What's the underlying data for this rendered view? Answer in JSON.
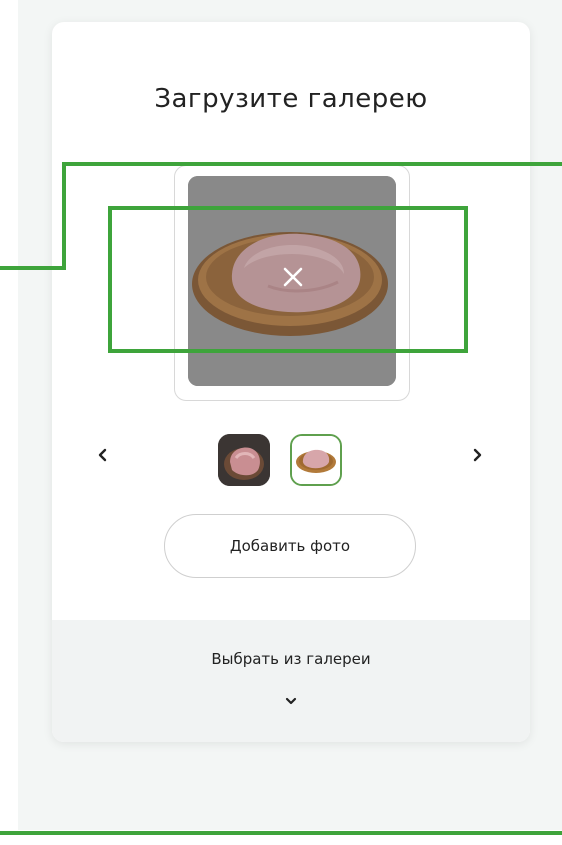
{
  "card": {
    "title": "Загрузите галерею",
    "add_photo_label": "Добавить фото",
    "gallery_select_label": "Выбрать из галереи"
  },
  "preview": {
    "image_icon": "meat-on-board-image",
    "remove_icon": "close-icon"
  },
  "carousel": {
    "prev_icon": "chevron-left-icon",
    "next_icon": "chevron-right-icon",
    "thumbnails": [
      "meat-photo-1",
      "meat-photo-2"
    ],
    "selected_index": 1
  },
  "colors": {
    "annotation_green": "#3ea43b",
    "accent_border": "#5fa04e",
    "panel_bg": "#f1f3f3",
    "page_bg": "#f3f6f5"
  }
}
